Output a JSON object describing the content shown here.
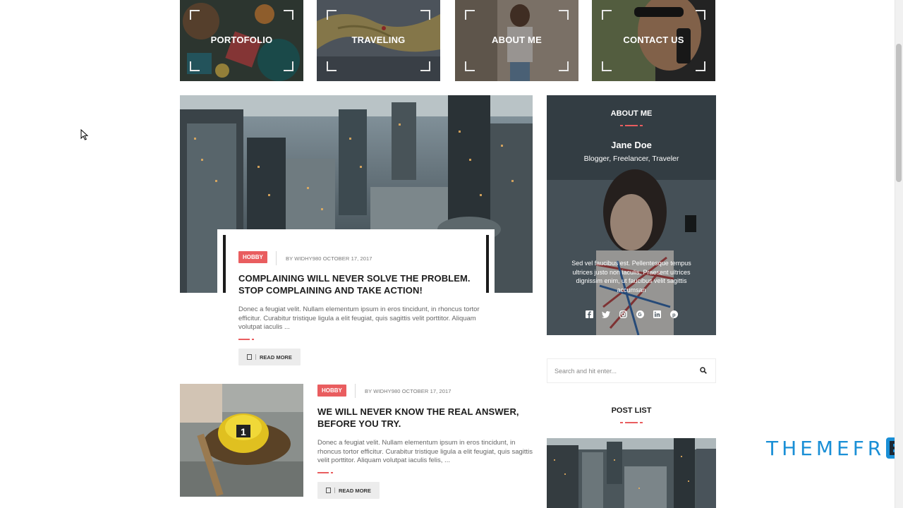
{
  "tiles": [
    {
      "label": "PORTOFOLIO"
    },
    {
      "label": "TRAVELING"
    },
    {
      "label": "ABOUT ME"
    },
    {
      "label": "CONTACT US"
    }
  ],
  "featured_post": {
    "category": "HOBBY",
    "meta": "BY WIDHY980  OCTOBER 17, 2017",
    "title": "COMPLAINING WILL NEVER SOLVE THE PROBLEM. STOP COMPLAINING AND TAKE ACTION!",
    "excerpt": "Donec a feugiat velit. Nullam elementum ipsum in eros tincidunt, in rhoncus tortor efficitur. Curabitur tristique ligula a elit feugiat, quis sagittis velit porttitor. Aliquam volutpat iaculis ...",
    "read_more": "READ MORE"
  },
  "second_post": {
    "category": "HOBBY",
    "meta": "BY WIDHY980  OCTOBER 17, 2017",
    "title": "WE WILL NEVER KNOW THE REAL ANSWER, BEFORE YOU TRY.",
    "excerpt": "Donec a feugiat velit. Nullam elementum ipsum in eros tincidunt, in rhoncus tortor efficitur. Curabitur tristique ligula a elit feugiat, quis sagittis velit porttitor. Aliquam volutpat iaculis felis, ...",
    "read_more": "READ MORE"
  },
  "sidebar": {
    "about": {
      "title": "ABOUT ME",
      "name": "Jane Doe",
      "role": "Blogger, Freelancer, Traveler",
      "bio": "Sed vel faucibus est. Pellentesque tempus ultrices justo non iaculis. Praesent ultrices dignissim enim, ut faucibus velit sagittis accumsan",
      "socials": [
        "facebook-icon",
        "twitter-icon",
        "instagram-icon",
        "google-plus-icon",
        "linkedin-icon",
        "pinterest-icon"
      ]
    },
    "search": {
      "placeholder": "Search and hit enter..."
    },
    "post_list_title": "POST LIST"
  },
  "watermark": {
    "text": "THEMEFR"
  },
  "colors": {
    "accent": "#e95d5f",
    "watermark_blue": "#1a8fd6"
  }
}
